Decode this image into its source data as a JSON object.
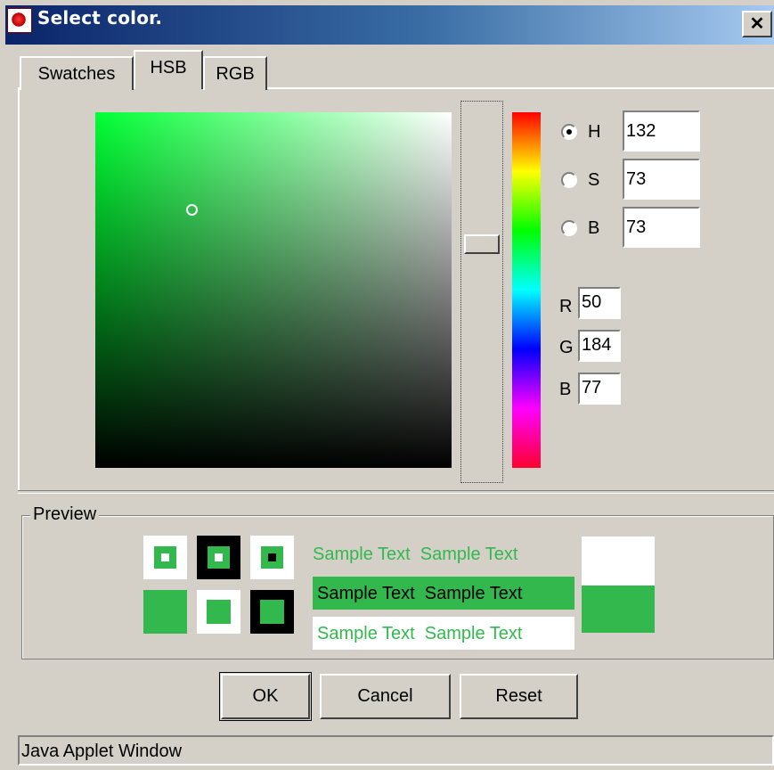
{
  "window": {
    "title": "Select color.",
    "close_glyph": "✕"
  },
  "tabs": [
    {
      "label": "Swatches",
      "active": false
    },
    {
      "label": "HSB",
      "active": true
    },
    {
      "label": "RGB",
      "active": false
    }
  ],
  "hsb": {
    "selected_channel": "H",
    "H": {
      "label": "H",
      "value": "132"
    },
    "S": {
      "label": "S",
      "value": "73"
    },
    "B": {
      "label": "B",
      "value": "73"
    }
  },
  "rgb": {
    "R": {
      "label": "R",
      "value": "50"
    },
    "G": {
      "label": "G",
      "value": "184"
    },
    "B": {
      "label": "B",
      "value": "77"
    }
  },
  "colors": {
    "selected": "#32b84d",
    "hue_pure": "#00ff33"
  },
  "preview": {
    "label": "Preview",
    "sample_text": "Sample Text",
    "sample_row": "Sample Text  Sample Text"
  },
  "buttons": {
    "ok": "OK",
    "cancel": "Cancel",
    "reset": "Reset"
  },
  "status": {
    "text": "Java Applet Window"
  },
  "icons": {
    "app": "app-icon",
    "close": "close-icon"
  }
}
